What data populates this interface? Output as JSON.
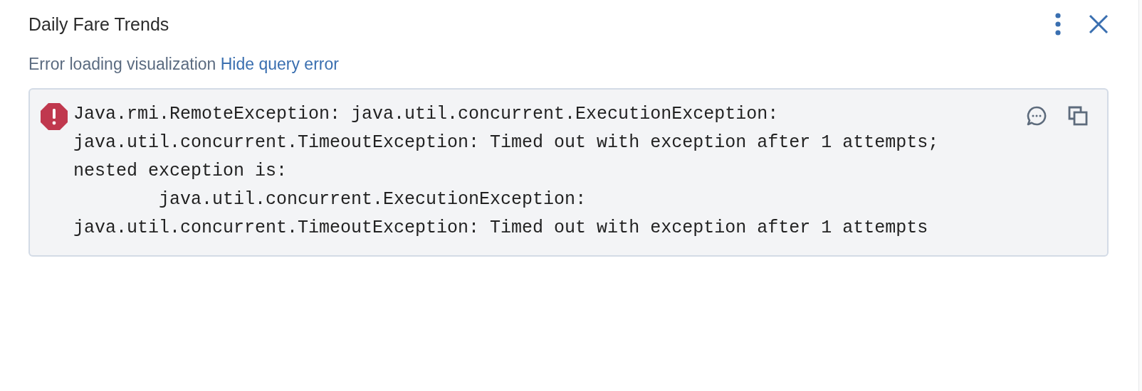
{
  "panel": {
    "title": "Daily Fare Trends"
  },
  "status": {
    "message": "Error loading visualization",
    "link": "Hide query error"
  },
  "error": {
    "message": "Java.rmi.RemoteException: java.util.concurrent.ExecutionException:\njava.util.concurrent.TimeoutException: Timed out with exception after 1 attempts;\nnested exception is:\n\tjava.util.concurrent.ExecutionException:\njava.util.concurrent.TimeoutException: Timed out with exception after 1 attempts"
  }
}
